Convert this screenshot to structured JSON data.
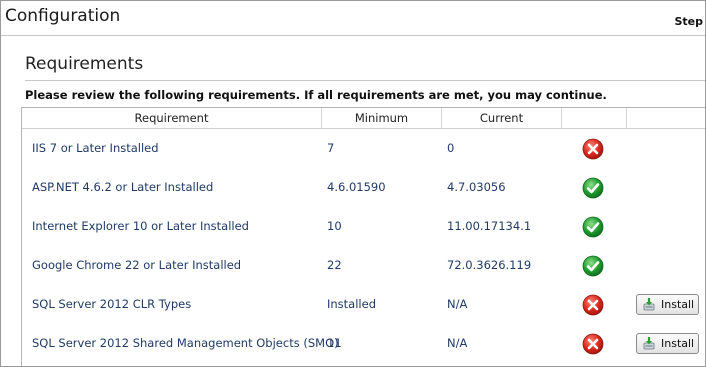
{
  "app": {
    "title": "Configuration",
    "step_label": "Step"
  },
  "section": {
    "title": "Requirements",
    "instructions": "Please review the following requirements.  If all requirements are met, you may continue."
  },
  "grid": {
    "headers": {
      "requirement": "Requirement",
      "minimum": "Minimum",
      "current": "Current",
      "status": "",
      "action": ""
    },
    "rows": [
      {
        "requirement": "IIS 7 or Later Installed",
        "minimum": "7",
        "current": "0",
        "status": "error-icon",
        "action": ""
      },
      {
        "requirement": "ASP.NET 4.6.2 or Later Installed",
        "minimum": "4.6.01590",
        "current": "4.7.03056",
        "status": "check-icon",
        "action": ""
      },
      {
        "requirement": "Internet Explorer 10 or Later Installed",
        "minimum": "10",
        "current": "11.00.17134.1",
        "status": "check-icon",
        "action": ""
      },
      {
        "requirement": "Google Chrome 22 or Later Installed",
        "minimum": "22",
        "current": "72.0.3626.119",
        "status": "check-icon",
        "action": ""
      },
      {
        "requirement": "SQL Server 2012 CLR Types",
        "minimum": "Installed",
        "current": "N/A",
        "status": "error-icon",
        "action": "Install"
      },
      {
        "requirement": "SQL Server 2012 Shared Management Objects (SMO)",
        "minimum": "11",
        "current": "N/A",
        "status": "error-icon",
        "action": "Install"
      }
    ]
  },
  "colors": {
    "error": "#d9261c",
    "ok": "#1e9a2e",
    "text_link": "#1f3a66"
  }
}
